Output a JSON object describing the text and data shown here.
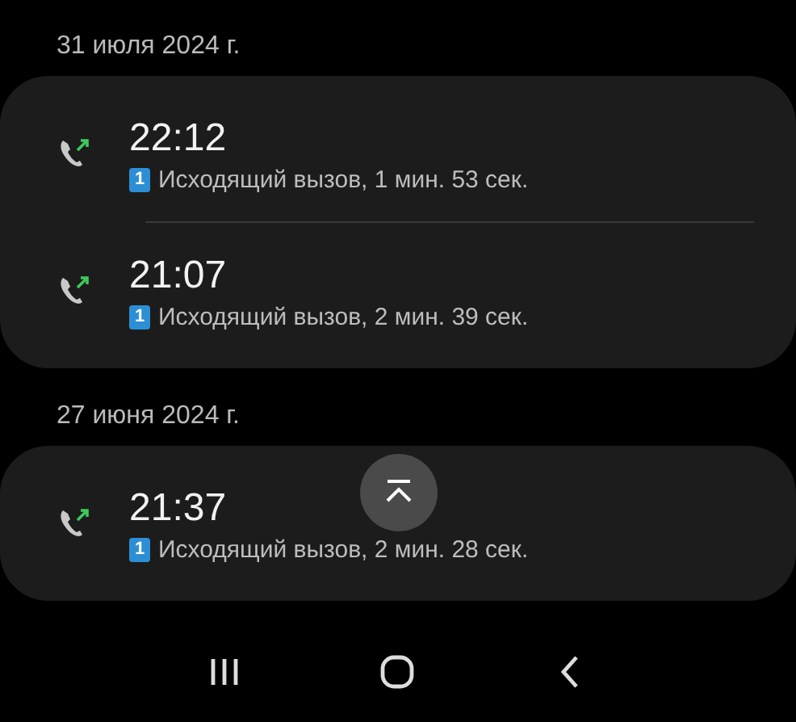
{
  "groups": [
    {
      "date": "31 июля 2024 г.",
      "calls": [
        {
          "kind": "outgoing",
          "time": "22:12",
          "sim": "1",
          "detail": "Исходящий вызов, 1 мин. 53 сек."
        },
        {
          "kind": "outgoing",
          "time": "21:07",
          "sim": "1",
          "detail": "Исходящий вызов, 2 мин. 39 сек."
        }
      ]
    },
    {
      "date": "27 июня 2024 г.",
      "calls": [
        {
          "kind": "outgoing",
          "time": "21:37",
          "sim": "1",
          "detail": "Исходящий вызов, 2 мин. 28 сек."
        }
      ]
    }
  ]
}
